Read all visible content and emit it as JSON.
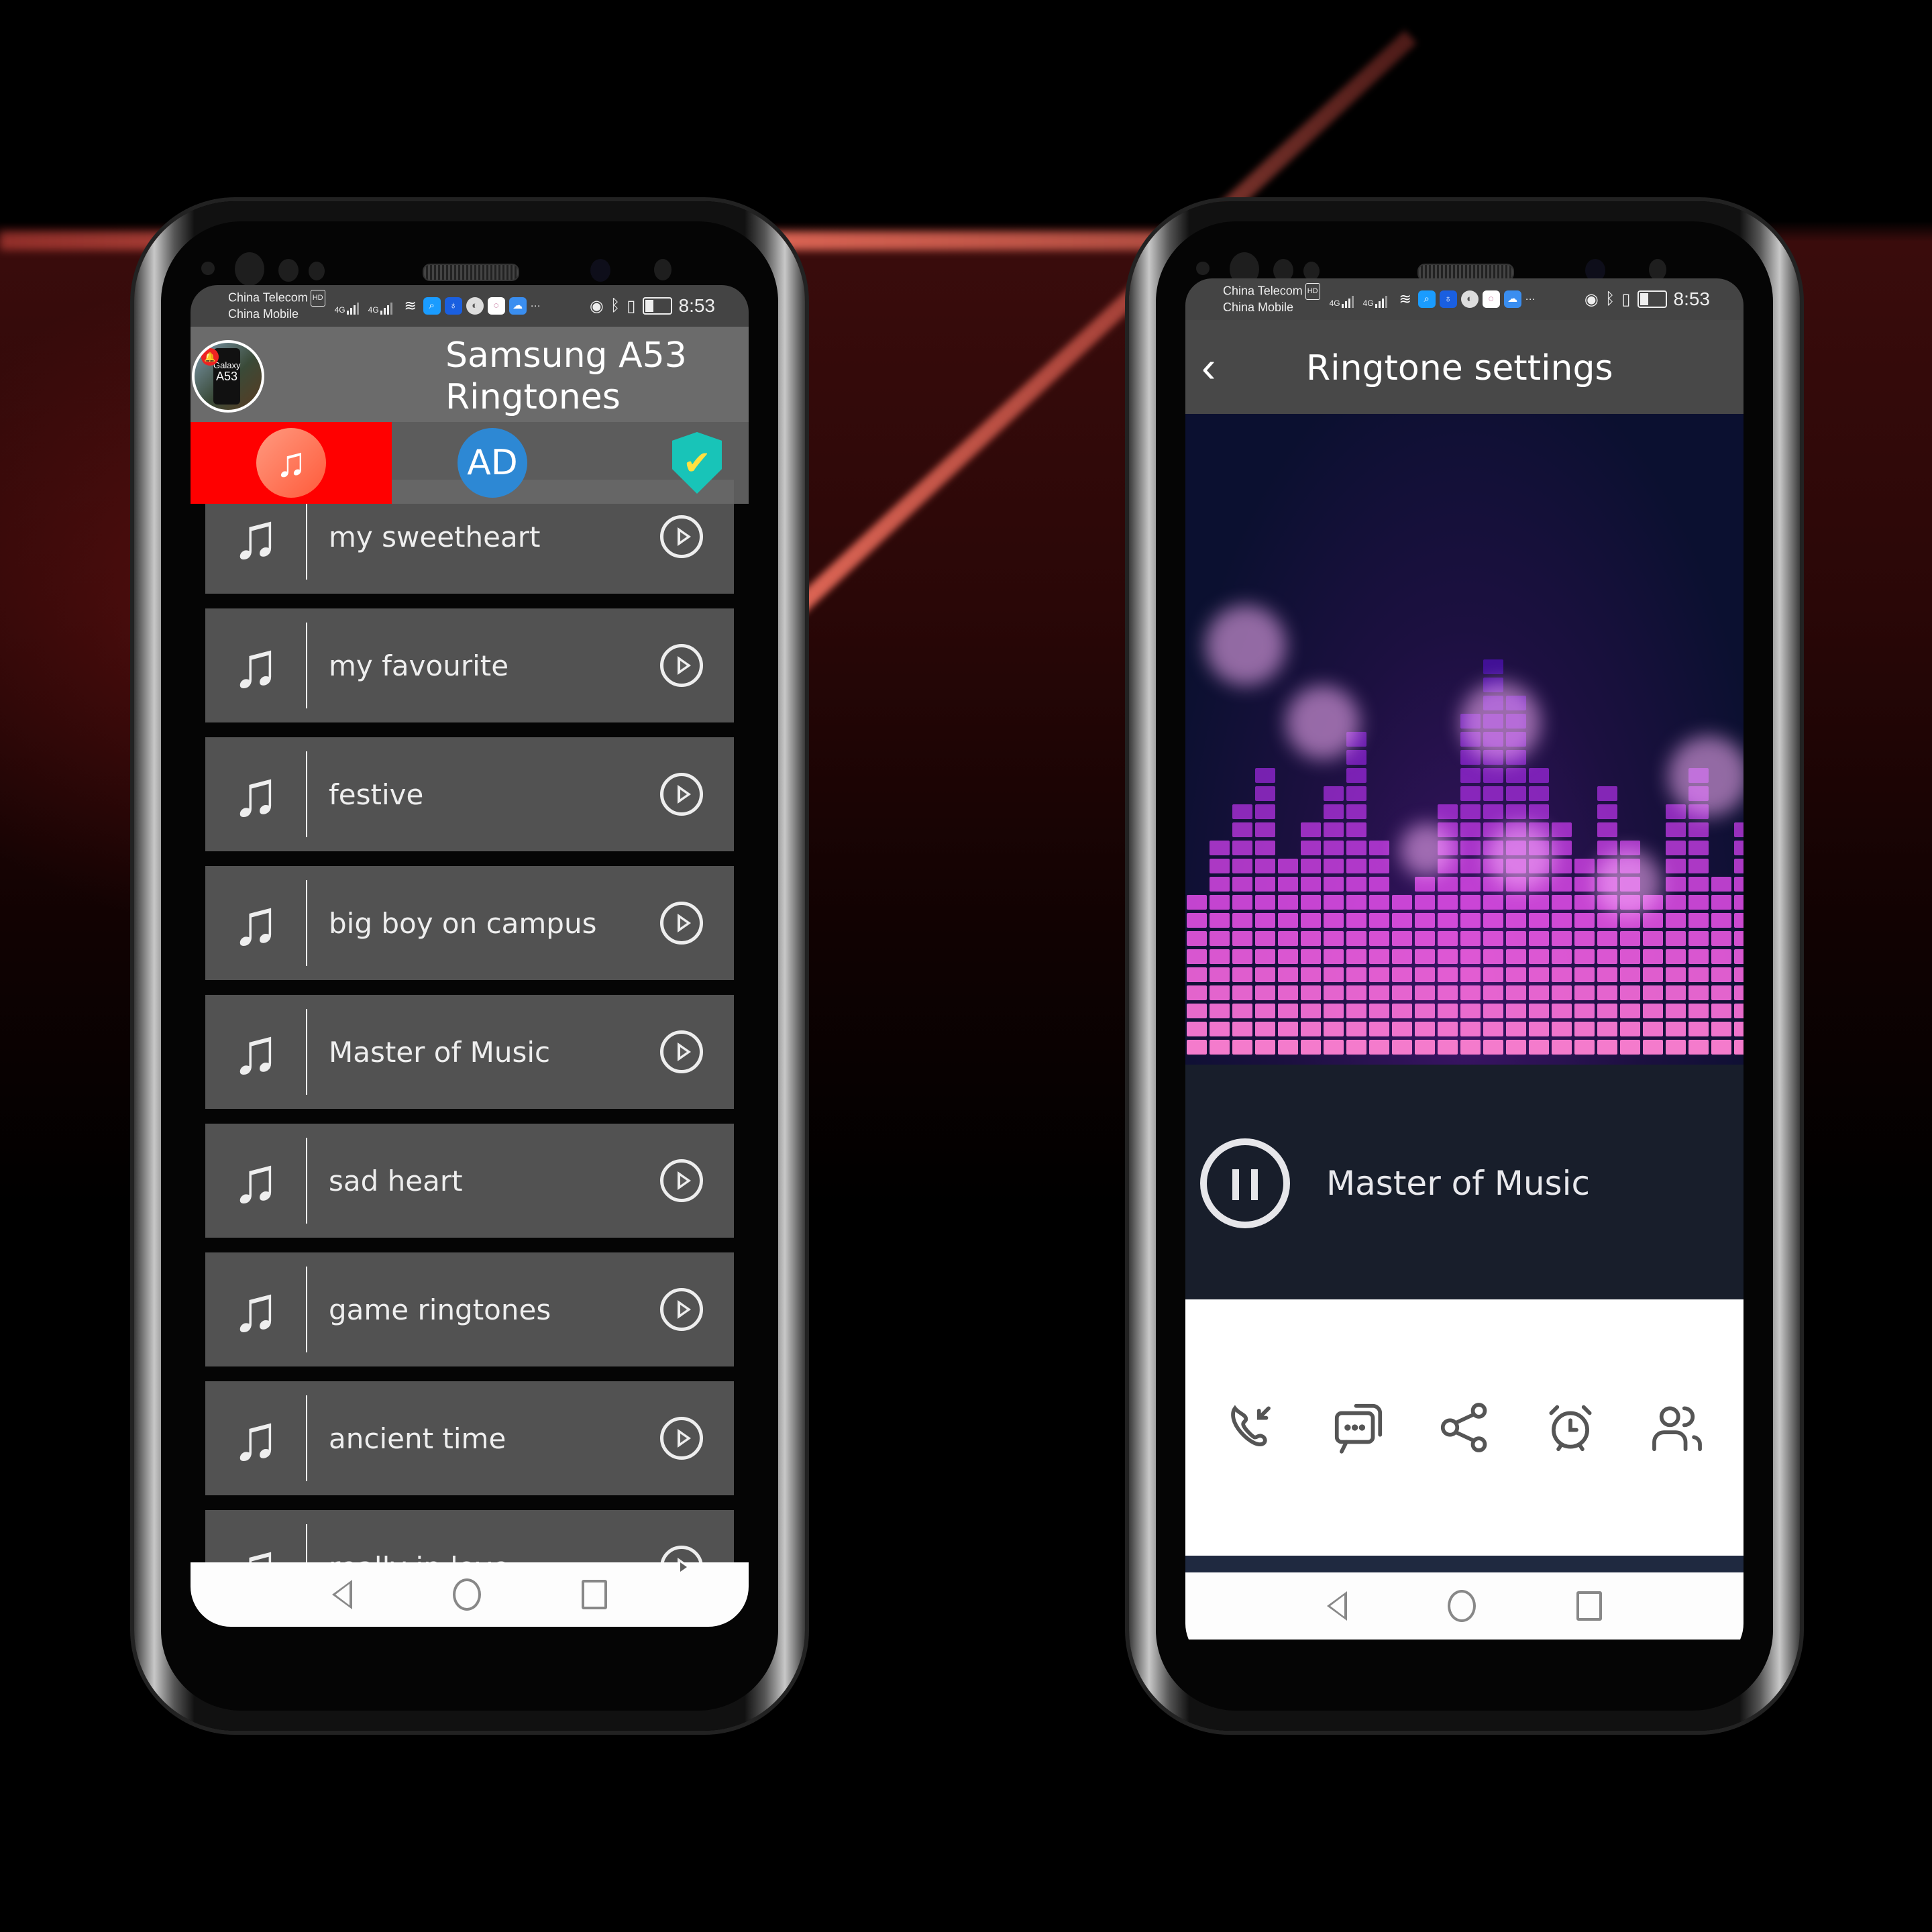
{
  "status_bar": {
    "carrier1": "China Telecom",
    "carrier1_badge": "HD",
    "carrier2": "China Mobile",
    "network1": "4G",
    "network2": "4G",
    "more": "···",
    "time": "8:53",
    "icons": [
      "signal-icon",
      "signal-icon",
      "wifi-icon",
      "search-app-icon",
      "bulb-app-icon",
      "browser-app-icon",
      "circle-app-icon",
      "cloud-app-icon",
      "eye-icon",
      "bluetooth-icon",
      "vibrate-icon",
      "battery-icon"
    ]
  },
  "left_app": {
    "logo": {
      "line1": "Galaxy",
      "line2": "A53"
    },
    "title": "Samsung A53 Ringtones",
    "title_line1": "Samsung A53",
    "title_line2": "Ringtones",
    "tabs": [
      {
        "name": "ringtones",
        "icon": "♫",
        "active": true,
        "color": "#ff0000"
      },
      {
        "name": "ad",
        "label": "AD",
        "active": false,
        "color": "#2d88d4"
      },
      {
        "name": "privacy",
        "icon": "✔",
        "active": false,
        "color": "#18c4b8"
      }
    ],
    "ringtones": [
      {
        "title": "my sweetheart"
      },
      {
        "title": "my favourite"
      },
      {
        "title": "festive"
      },
      {
        "title": "big boy on campus"
      },
      {
        "title": "Master of Music"
      },
      {
        "title": "sad heart"
      },
      {
        "title": "game ringtones"
      },
      {
        "title": "ancient time"
      },
      {
        "title": "really in love"
      }
    ],
    "row_icon": "♫"
  },
  "right_app": {
    "back_icon": "‹",
    "title": "Ringtone settings",
    "now_playing": "Master of Music",
    "player_state": "playing",
    "actions": [
      {
        "name": "set-as-ringtone",
        "icon": "phone-incoming-icon"
      },
      {
        "name": "set-as-notification",
        "icon": "message-icon"
      },
      {
        "name": "share",
        "icon": "share-icon"
      },
      {
        "name": "set-as-alarm",
        "icon": "alarm-icon"
      },
      {
        "name": "set-for-contact",
        "icon": "contacts-icon"
      }
    ]
  },
  "navbar": {
    "back": "back",
    "home": "home",
    "recents": "recents"
  },
  "colors": {
    "accent_red": "#ff0000",
    "ad_blue": "#2d88d4",
    "shield_teal": "#18c4b8",
    "player_bg": "#181e2b"
  }
}
